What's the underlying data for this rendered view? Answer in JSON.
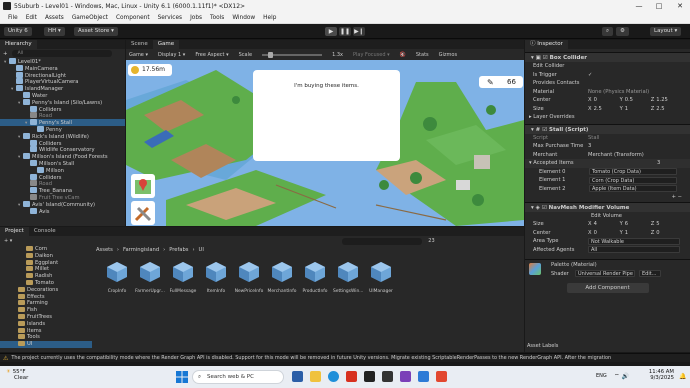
{
  "window": {
    "title": "5Suburb - Level01 - Windows, Mac, Linux - Unity 6.1 (6000.1.11f1)* <DX12>",
    "minimize": "—",
    "maximize": "□",
    "close": "✕"
  },
  "menu": [
    "File",
    "Edit",
    "Assets",
    "GameObject",
    "Component",
    "Services",
    "Jobs",
    "Tools",
    "Window",
    "Help"
  ],
  "toolbar": {
    "unity_label": "Unity 6",
    "account": "HH",
    "asset_store": "Asset Store",
    "layout": "Layout"
  },
  "hierarchy": {
    "tab": "Hierarchy",
    "add": "+",
    "search_placeholder": "All",
    "items": [
      {
        "indent": 0,
        "label": "Level01*",
        "kind": "scene",
        "arrow": "▾"
      },
      {
        "indent": 1,
        "label": "MainCamera",
        "kind": "cube",
        "arrow": ""
      },
      {
        "indent": 1,
        "label": "DirectionalLight",
        "kind": "cube",
        "arrow": ""
      },
      {
        "indent": 1,
        "label": "PlayerVirtualCamera",
        "kind": "cube",
        "arrow": ""
      },
      {
        "indent": 1,
        "label": "IslandManager",
        "kind": "cube",
        "arrow": "▾"
      },
      {
        "indent": 2,
        "label": "Water",
        "kind": "cube",
        "arrow": ""
      },
      {
        "indent": 2,
        "label": "Penny's Island (Silo/Lawns)",
        "kind": "cube",
        "arrow": "▾"
      },
      {
        "indent": 3,
        "label": "Colliders",
        "kind": "cube",
        "arrow": ""
      },
      {
        "indent": 3,
        "label": "Road",
        "kind": "grey",
        "arrow": ""
      },
      {
        "indent": 3,
        "label": "Penny's Stall",
        "kind": "cube",
        "arrow": "▾",
        "selected": true
      },
      {
        "indent": 4,
        "label": "Penny",
        "kind": "cube",
        "arrow": ""
      },
      {
        "indent": 2,
        "label": "Rick's Island (Wildlife)",
        "kind": "cube",
        "arrow": "▾"
      },
      {
        "indent": 3,
        "label": "Colliders",
        "kind": "cube",
        "arrow": ""
      },
      {
        "indent": 3,
        "label": "Wildlife Conservatory",
        "kind": "cube",
        "arrow": ""
      },
      {
        "indent": 2,
        "label": "Millson's Island (Food Forests",
        "kind": "cube",
        "arrow": "▾"
      },
      {
        "indent": 3,
        "label": "Millson's Stall",
        "kind": "cube",
        "arrow": ""
      },
      {
        "indent": 4,
        "label": "Millson",
        "kind": "cube",
        "arrow": ""
      },
      {
        "indent": 3,
        "label": "Colliders",
        "kind": "cube",
        "arrow": ""
      },
      {
        "indent": 3,
        "label": "Road",
        "kind": "grey",
        "arrow": ""
      },
      {
        "indent": 3,
        "label": "Tree_Banana",
        "kind": "cube",
        "arrow": ""
      },
      {
        "indent": 3,
        "label": "Fruit Tree vCam",
        "kind": "grey",
        "arrow": ""
      },
      {
        "indent": 2,
        "label": "Avis' Island(Community)",
        "kind": "cube",
        "arrow": "▾"
      },
      {
        "indent": 3,
        "label": "Avis",
        "kind": "cube",
        "arrow": ""
      }
    ]
  },
  "scene_view": {
    "tabs": [
      "Scene",
      "Game"
    ],
    "active_tab": "Game",
    "game_label": "Game",
    "display": "Display 1",
    "aspect": "Free Aspect",
    "scale_label": "Scale",
    "scale_value": "1.3x",
    "play_focused": "Play Focused",
    "stats": "Stats",
    "gizmos": "Gizmos",
    "hud_coins": "17.56m",
    "hud_count": "66",
    "dialog_text": "I'm buying these items."
  },
  "inspector": {
    "tab": "Inspector",
    "box_collider": {
      "title": "Box Collider",
      "edit": "Edit Collider",
      "is_trigger": "Is Trigger",
      "is_trigger_value": "✓",
      "provides_contacts": "Provides Contacts",
      "material": "Material",
      "material_value": "None (Physics Material)",
      "center": "Center",
      "center_x": "0",
      "center_y": "0.5",
      "center_z": "1.25",
      "size": "Size",
      "size_x": "2.5",
      "size_y": "1",
      "size_z": "2.5",
      "layer_overrides": "Layer Overrides",
      "x": "X",
      "y": "Y",
      "z": "Z"
    },
    "stall": {
      "title": "Stall (Script)",
      "script_label": "Script",
      "script_value": "Stall",
      "max_purchase": "Max Purchase Time",
      "max_purchase_value": "3",
      "merchant": "Merchant",
      "merchant_value": "Merchant (Transform)",
      "accepted": "Accepted Items",
      "accepted_count": "3",
      "elements": [
        {
          "label": "Element 0",
          "value": "Tomato (Crop Data)"
        },
        {
          "label": "Element 1",
          "value": "Corn (Crop Data)"
        },
        {
          "label": "Element 2",
          "value": "Apple (Item Data)"
        }
      ]
    },
    "navmesh": {
      "title": "NavMesh Modifier Volume",
      "edit": "Edit Volume",
      "size": "Size",
      "size_x": "4",
      "size_y": "6",
      "size_z": "5",
      "center": "Center",
      "center_x": "0",
      "center_y": "1",
      "center_z": "0",
      "area_type": "Area Type",
      "area_type_value": "Not Walkable",
      "affected_agents": "Affected Agents",
      "affected_agents_value": "All"
    },
    "palette": {
      "title": "Palette (Material)",
      "shader_label": "Shader",
      "shader_value": "Universal Render Pipe",
      "edit": "Edit..."
    },
    "add_component": "Add Component",
    "asset_labels": "Asset Labels"
  },
  "project": {
    "tabs": [
      "Project",
      "Console"
    ],
    "breadcrumb": [
      "Assets",
      "Farmingisland",
      "Prefabs",
      "UI"
    ],
    "count": "23",
    "tree": [
      {
        "indent": 2,
        "label": "Corn",
        "kind": "folder"
      },
      {
        "indent": 2,
        "label": "Daikon",
        "kind": "folder"
      },
      {
        "indent": 2,
        "label": "Eggplant",
        "kind": "folder"
      },
      {
        "indent": 2,
        "label": "Millet",
        "kind": "folder"
      },
      {
        "indent": 2,
        "label": "Radish",
        "kind": "folder"
      },
      {
        "indent": 2,
        "label": "Tomato",
        "kind": "folder"
      },
      {
        "indent": 1,
        "label": "Decorations",
        "kind": "folder"
      },
      {
        "indent": 1,
        "label": "Effects",
        "kind": "folder"
      },
      {
        "indent": 1,
        "label": "Farming",
        "kind": "folder"
      },
      {
        "indent": 1,
        "label": "Fish",
        "kind": "folder"
      },
      {
        "indent": 1,
        "label": "FruitTrees",
        "kind": "folder"
      },
      {
        "indent": 1,
        "label": "Islands",
        "kind": "folder"
      },
      {
        "indent": 1,
        "label": "Items",
        "kind": "folder"
      },
      {
        "indent": 1,
        "label": "Tools",
        "kind": "folder"
      },
      {
        "indent": 1,
        "label": "UI",
        "kind": "folder",
        "selected": true
      }
    ],
    "assets": [
      "CropInfo",
      "FarmerUpgr...",
      "FullMessage",
      "ItemInfo",
      "NewPriceInfo",
      "MerchantInfo",
      "ProductInfo",
      "SettingsWin...",
      "UIManager"
    ]
  },
  "warning": "The project currently uses the compatibility mode where the Render Graph API is disabled. Support for this mode will be removed in future Unity versions. Migrate existing ScriptableRenderPasses to the new RenderGraph API. After the migration",
  "taskbar": {
    "temp": "55°F",
    "weather": "Clear",
    "search": "Search web & PC",
    "lang": "ENG",
    "time": "11:46 AM",
    "date": "9/3/2025"
  },
  "colors": {
    "accent": "#2c5d87",
    "sky": "#7fb2e6",
    "grass": "#5fae4c"
  }
}
